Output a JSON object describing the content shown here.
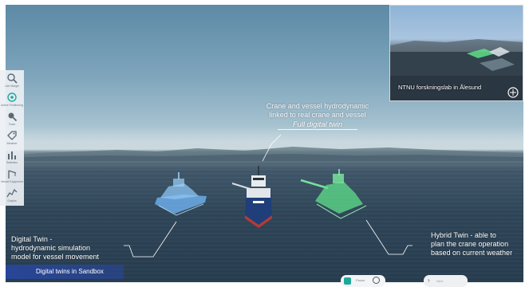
{
  "toolbar": {
    "items": [
      {
        "label": "Live Margin",
        "icon": "zoom-icon"
      },
      {
        "label": "Active Positioning",
        "icon": "target-icon"
      },
      {
        "label": "Tools",
        "icon": "search-icon"
      },
      {
        "label": "Weather",
        "icon": "tag-icon"
      },
      {
        "label": "Statistics",
        "icon": "bar-chart-icon"
      },
      {
        "label": "Vessel Equipment",
        "icon": "crane-icon"
      },
      {
        "label": "Graphs",
        "icon": "line-chart-icon"
      }
    ]
  },
  "pip": {
    "label": "NTNU forskningslab in Ålesund"
  },
  "annotations": {
    "center_line1": "Crane and vessel hydrodynamic",
    "center_line2": "linked to real crane and vessel",
    "center_emphasis": "Full digital twin",
    "left_line1": "Digital Twin -",
    "left_line2": "hydrodynamic simulation",
    "left_line3": "model for vessel movement",
    "right_line1": "Hybrid Twin - able to",
    "right_line2": "plan the crane operation",
    "right_line3": "based on current weather"
  },
  "bottom_bar": {
    "label": "Digital twins in Sandbox"
  },
  "controls": {
    "pause_label": "Pause",
    "next_label": "Next"
  },
  "colors": {
    "digital_twin": "#6fb2f0",
    "hybrid_twin": "#5fe089",
    "real_vessel_hull": "#1f3e7a",
    "bottom_bar": "#2846a0"
  }
}
